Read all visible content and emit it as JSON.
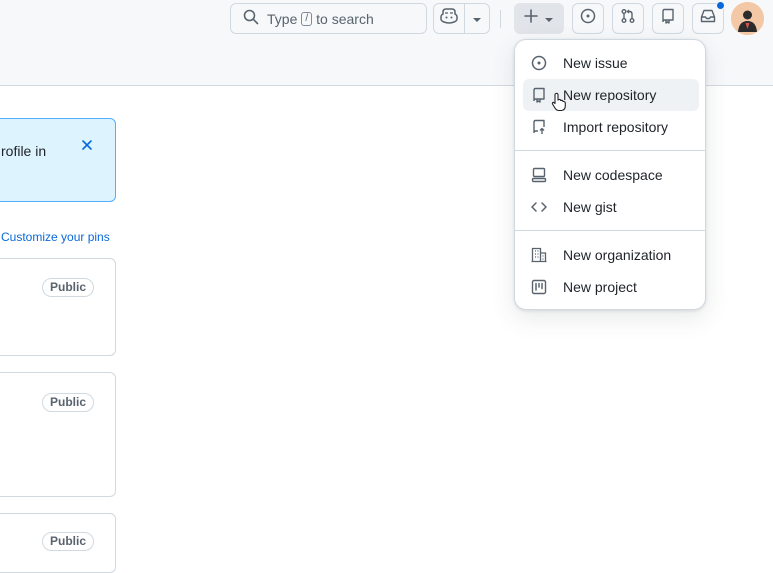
{
  "header": {
    "search": {
      "prefix": "Type",
      "key": "/",
      "suffix": "to search"
    },
    "icons": {
      "copilot": "copilot-icon",
      "create": "plus-icon",
      "issues": "issue-opened-icon",
      "pulls": "git-pull-request-icon",
      "repos": "repo-icon",
      "inbox": "inbox-icon"
    },
    "has_unread_notifications": true
  },
  "main": {
    "flash": {
      "text": "rofile in"
    },
    "customize_pins_label": "Customize your pins",
    "pins": [
      {
        "visibility": "Public"
      },
      {
        "visibility": "Public"
      },
      {
        "visibility": "Public"
      }
    ]
  },
  "create_menu": {
    "groups": [
      [
        {
          "label": "New issue",
          "icon": "issue-opened-icon"
        },
        {
          "label": "New repository",
          "icon": "repo-icon",
          "hovered": true
        },
        {
          "label": "Import repository",
          "icon": "repo-push-icon"
        }
      ],
      [
        {
          "label": "New codespace",
          "icon": "codespaces-icon"
        },
        {
          "label": "New gist",
          "icon": "code-icon"
        }
      ],
      [
        {
          "label": "New organization",
          "icon": "organization-icon"
        },
        {
          "label": "New project",
          "icon": "project-icon"
        }
      ]
    ]
  },
  "colors": {
    "accent": "#0969da",
    "header_bg": "#f6f8fa",
    "flash_bg": "#ddf4ff",
    "flash_border": "#54aeff",
    "border": "#d1d9e0"
  }
}
